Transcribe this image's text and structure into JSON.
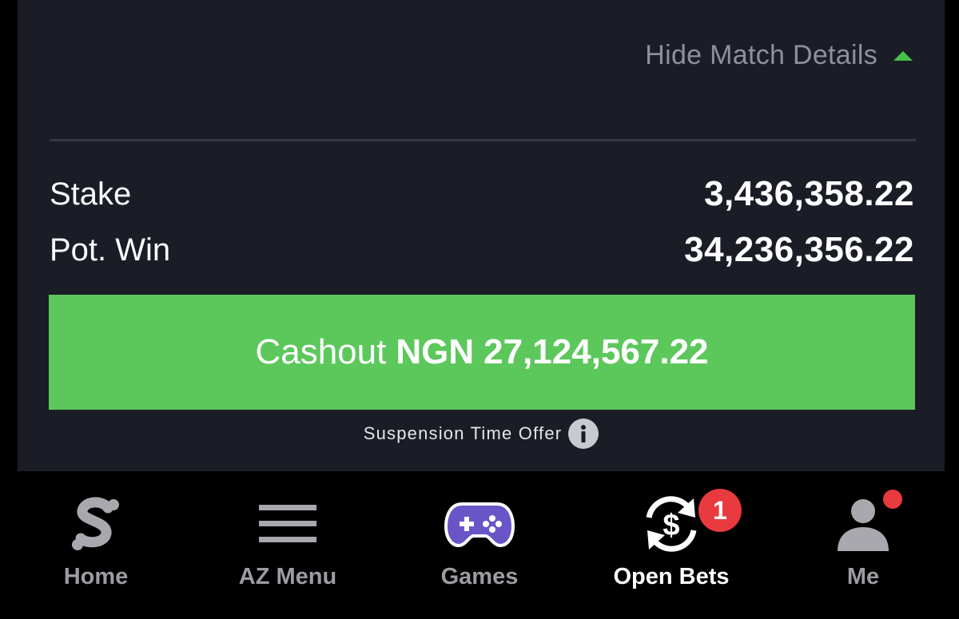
{
  "details": {
    "toggle_label": "Hide Match Details"
  },
  "summary": {
    "stake_label": "Stake",
    "stake_value": "3,436,358.22",
    "win_label": "Pot. Win",
    "win_value": "34,236,356.22"
  },
  "cashout": {
    "prefix": "Cashout",
    "currency": "NGN",
    "amount": "27,124,567.22"
  },
  "suspension": {
    "text": "Suspension Time Offer"
  },
  "nav": {
    "items": [
      {
        "label": "Home",
        "icon": "sportybet-s-logo-icon"
      },
      {
        "label": "AZ Menu",
        "icon": "hamburger-menu-icon"
      },
      {
        "label": "Games",
        "icon": "gamepad-icon"
      },
      {
        "label": "Open Bets",
        "icon": "cashout-dollar-arrows-icon",
        "badge": "1"
      },
      {
        "label": "Me",
        "icon": "user-icon"
      }
    ],
    "active_index": 3
  },
  "colors": {
    "accent_green": "#5cc85c",
    "caret_green": "#47c04a",
    "badge_red": "#e83a3f",
    "card_bg": "#1b1d26",
    "games_purple": "#6a55c8"
  }
}
